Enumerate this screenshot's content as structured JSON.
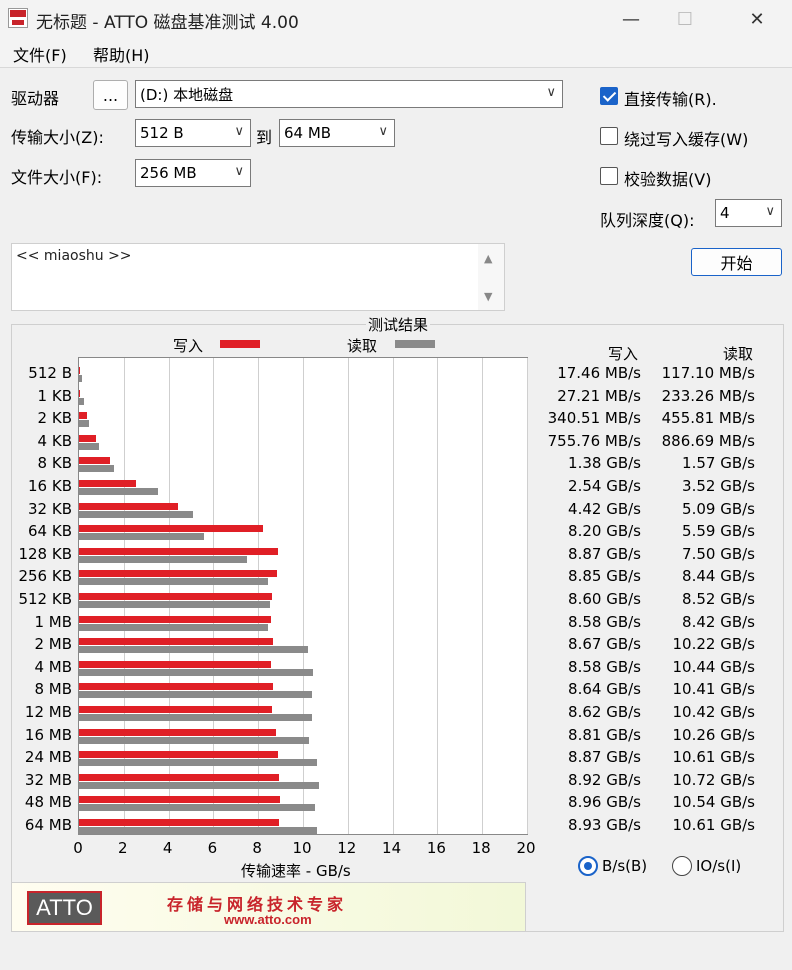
{
  "window": {
    "title": "无标题 - ATTO 磁盘基准测试 4.00",
    "minimize_glyph": "—",
    "maximize_glyph": "☐",
    "close_glyph": "✕"
  },
  "menu": {
    "file": "文件(F)",
    "help": "帮助(H)"
  },
  "form": {
    "drive_label": "驱动器",
    "browse_label": "...",
    "drive_value": "(D:) 本地磁盘",
    "transfer_label": "传输大小(Z):",
    "transfer_from": "512 B",
    "to_label": "到",
    "transfer_to": "64 MB",
    "filesize_label": "文件大小(F):",
    "filesize_value": "256 MB",
    "direct_io_label": "直接传输(R).",
    "bypass_cache_label": "绕过写入缓存(W)",
    "verify_label": "校验数据(V)",
    "queue_label": "队列深度(Q):",
    "queue_value": "4",
    "start_label": "开始",
    "description": "<< miaoshu >>",
    "dropdown_glyph": "∨",
    "scroll_up_glyph": "▲",
    "scroll_down_glyph": "▼"
  },
  "colors": {
    "write": "#e01f26",
    "read": "#8a8a8a",
    "accent": "#1a63c9"
  },
  "results": {
    "title": "测试结果",
    "write_legend": "写入",
    "read_legend": "读取",
    "write_header": "写入",
    "read_header": "读取",
    "xlabel": "传输速率 - GB/s",
    "unit_bytes": "B/s(B)",
    "unit_io": "IO/s(I)"
  },
  "chart_data": {
    "type": "bar",
    "orientation": "horizontal",
    "categories": [
      "512 B",
      "1 KB",
      "2 KB",
      "4 KB",
      "8 KB",
      "16 KB",
      "32 KB",
      "64 KB",
      "128 KB",
      "256 KB",
      "512 KB",
      "1 MB",
      "2 MB",
      "4 MB",
      "8 MB",
      "12 MB",
      "16 MB",
      "24 MB",
      "32 MB",
      "48 MB",
      "64 MB"
    ],
    "series": [
      {
        "name": "写入",
        "values": [
          0.01746,
          0.02721,
          0.34051,
          0.75576,
          1.38,
          2.54,
          4.42,
          8.2,
          8.87,
          8.85,
          8.6,
          8.58,
          8.67,
          8.58,
          8.64,
          8.62,
          8.81,
          8.87,
          8.92,
          8.96,
          8.93
        ]
      },
      {
        "name": "读取",
        "values": [
          0.1171,
          0.23326,
          0.45581,
          0.88669,
          1.57,
          3.52,
          5.09,
          5.59,
          7.5,
          8.44,
          8.52,
          8.42,
          10.22,
          10.44,
          10.41,
          10.42,
          10.26,
          10.61,
          10.72,
          10.54,
          10.61
        ]
      }
    ],
    "write_text": [
      "17.46 MB/s",
      "27.21 MB/s",
      "340.51 MB/s",
      "755.76 MB/s",
      "1.38 GB/s",
      "2.54 GB/s",
      "4.42 GB/s",
      "8.20 GB/s",
      "8.87 GB/s",
      "8.85 GB/s",
      "8.60 GB/s",
      "8.58 GB/s",
      "8.67 GB/s",
      "8.58 GB/s",
      "8.64 GB/s",
      "8.62 GB/s",
      "8.81 GB/s",
      "8.87 GB/s",
      "8.92 GB/s",
      "8.96 GB/s",
      "8.93 GB/s"
    ],
    "read_text": [
      "117.10 MB/s",
      "233.26 MB/s",
      "455.81 MB/s",
      "886.69 MB/s",
      "1.57 GB/s",
      "3.52 GB/s",
      "5.09 GB/s",
      "5.59 GB/s",
      "7.50 GB/s",
      "8.44 GB/s",
      "8.52 GB/s",
      "8.42 GB/s",
      "10.22 GB/s",
      "10.44 GB/s",
      "10.41 GB/s",
      "10.42 GB/s",
      "10.26 GB/s",
      "10.61 GB/s",
      "10.72 GB/s",
      "10.54 GB/s",
      "10.61 GB/s"
    ],
    "xticks": [
      "0",
      "2",
      "4",
      "6",
      "8",
      "10",
      "12",
      "14",
      "16",
      "18",
      "20"
    ],
    "xlim": [
      0,
      20
    ],
    "xlabel": "传输速率 - GB/s",
    "grid": true,
    "legend": "top"
  },
  "banner": {
    "logo": "ATTO",
    "slogan": "存储与网络技术专家",
    "url": "www.atto.com"
  }
}
